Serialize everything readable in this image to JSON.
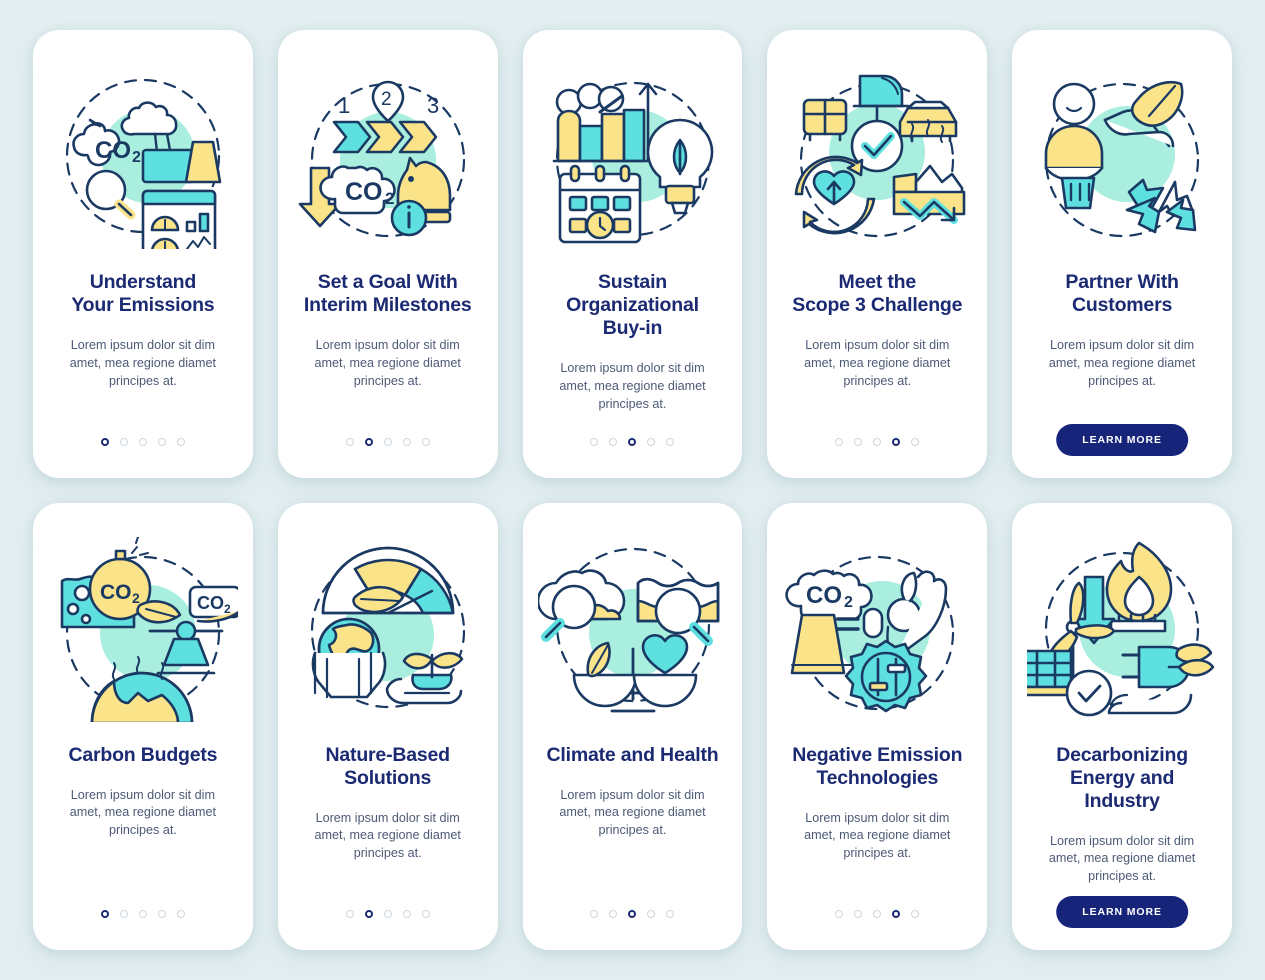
{
  "theme": {
    "page_background": "#e2eef0",
    "card_background": "#ffffff",
    "title_color": "#1b2a72",
    "body_color": "#4d5a76",
    "accent_navy": "#16257a",
    "accent_cyan": "#5ee0e0",
    "accent_yellow": "#fbe38a",
    "accent_mint": "#a9eede",
    "dot_inactive": "#cfd6dd"
  },
  "common": {
    "body_text": "Lorem ipsum dolor sit dim amet, mea regione diamet principes at.",
    "cta_label": "LEARN MORE",
    "dot_count": 5
  },
  "rows": [
    {
      "cards": [
        {
          "id": "understand-your-emissions",
          "title": "Understand\nYour Emissions",
          "body": "Lorem ipsum dolor sit dim amet, mea regione diamet principes at.",
          "icon": "co2-factory-dashboard-icon",
          "active_dot": 1,
          "has_cta": false
        },
        {
          "id": "set-a-goal-with-interim-milestones",
          "title": "Set a Goal With\nInterim Milestones",
          "body": "Lorem ipsum dolor sit dim amet, mea regione diamet principes at.",
          "icon": "milestones-co2-knight-icon",
          "active_dot": 2,
          "has_cta": false
        },
        {
          "id": "sustain-organizational-buy-in",
          "title": "Sustain Organizational\nBuy-in",
          "body": "Lorem ipsum dolor sit dim amet, mea regione diamet principes at.",
          "icon": "growth-chart-calendar-bulb-icon",
          "active_dot": 3,
          "has_cta": false
        },
        {
          "id": "meet-the-scope-3-challenge",
          "title": "Meet the\nScope 3 Challenge",
          "body": "Lorem ipsum dolor sit dim amet, mea regione diamet principes at.",
          "icon": "transport-supplychain-icon",
          "active_dot": 4,
          "has_cta": false
        },
        {
          "id": "partner-with-customers",
          "title": "Partner With\nCustomers",
          "body": "Lorem ipsum dolor sit dim amet, mea regione diamet principes at.",
          "icon": "shopper-leaf-recycle-icon",
          "active_dot": 5,
          "has_cta": true
        }
      ]
    },
    {
      "cards": [
        {
          "id": "carbon-budgets",
          "title": "Carbon Budgets",
          "body": "Lorem ipsum dolor sit dim amet, mea regione diamet principes at.",
          "icon": "carbon-budget-scale-earth-icon",
          "active_dot": 1,
          "has_cta": false
        },
        {
          "id": "nature-based-solutions",
          "title": "Nature-Based\nSolutions",
          "body": "Lorem ipsum dolor sit dim amet, mea regione diamet principes at.",
          "icon": "earth-hands-sprout-gauge-icon",
          "active_dot": 2,
          "has_cta": false
        },
        {
          "id": "climate-and-health",
          "title": "Climate and Health",
          "body": "Lorem ipsum dolor sit dim amet, mea regione diamet principes at.",
          "icon": "climate-health-balance-icon",
          "active_dot": 3,
          "has_cta": false
        },
        {
          "id": "negative-emission-technologies",
          "title": "Negative Emission\nTechnologies",
          "body": "Lorem ipsum dolor sit dim amet, mea regione diamet principes at.",
          "icon": "co2-zero-gear-hand-icon",
          "active_dot": 4,
          "has_cta": false
        },
        {
          "id": "decarbonizing-energy-and-industry",
          "title": "Decarbonizing\nEnergy and Industry",
          "body": "Lorem ipsum dolor sit dim amet, mea regione diamet principes at.",
          "icon": "renewable-energy-plug-icon",
          "active_dot": 5,
          "has_cta": true
        }
      ]
    }
  ]
}
